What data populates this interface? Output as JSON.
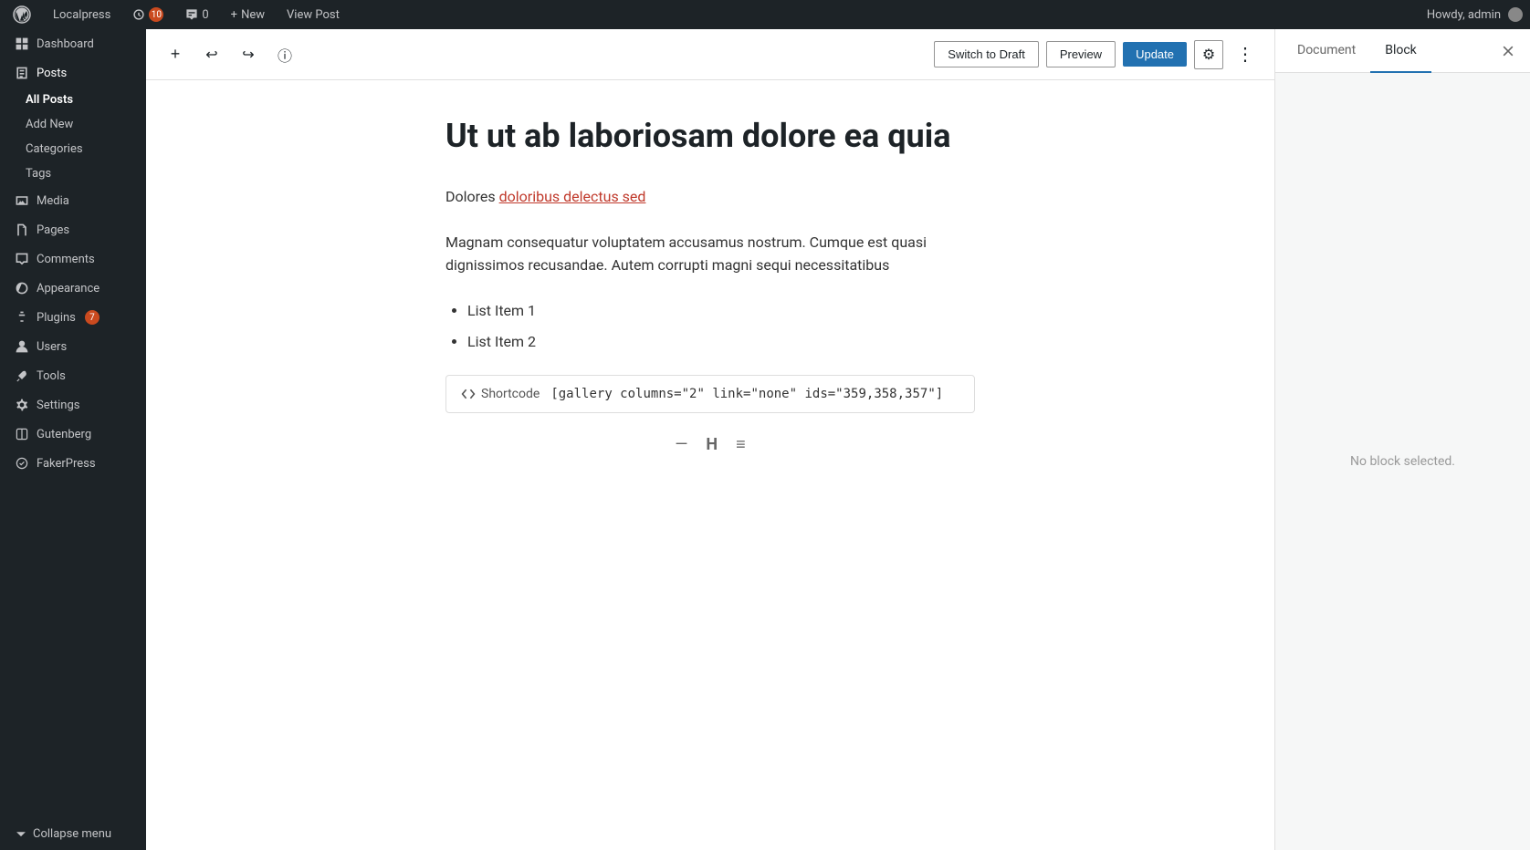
{
  "admin_bar": {
    "site_name": "Localpress",
    "updates_count": "10",
    "comments_count": "0",
    "new_label": "New",
    "view_post_label": "View Post",
    "howdy_label": "Howdy, admin"
  },
  "sidebar": {
    "brand": "Dashboard",
    "items": [
      {
        "id": "dashboard",
        "label": "Dashboard",
        "icon": "dashboard"
      },
      {
        "id": "posts",
        "label": "Posts",
        "icon": "posts",
        "active": true,
        "sub_items": [
          {
            "id": "all-posts",
            "label": "All Posts",
            "active": true
          },
          {
            "id": "add-new",
            "label": "Add New"
          },
          {
            "id": "categories",
            "label": "Categories"
          },
          {
            "id": "tags",
            "label": "Tags"
          }
        ]
      },
      {
        "id": "media",
        "label": "Media",
        "icon": "media"
      },
      {
        "id": "pages",
        "label": "Pages",
        "icon": "pages"
      },
      {
        "id": "comments",
        "label": "Comments",
        "icon": "comments"
      },
      {
        "id": "appearance",
        "label": "Appearance",
        "icon": "appearance"
      },
      {
        "id": "plugins",
        "label": "Plugins",
        "icon": "plugins",
        "badge": "7"
      },
      {
        "id": "users",
        "label": "Users",
        "icon": "users"
      },
      {
        "id": "tools",
        "label": "Tools",
        "icon": "tools"
      },
      {
        "id": "settings",
        "label": "Settings",
        "icon": "settings"
      },
      {
        "id": "gutenberg",
        "label": "Gutenberg",
        "icon": "gutenberg"
      },
      {
        "id": "fakerpress",
        "label": "FakerPress",
        "icon": "fakerpress"
      }
    ],
    "collapse_label": "Collapse menu"
  },
  "toolbar": {
    "switch_to_draft_label": "Switch to Draft",
    "preview_label": "Preview",
    "update_label": "Update"
  },
  "right_panel": {
    "tabs": [
      {
        "id": "document",
        "label": "Document"
      },
      {
        "id": "block",
        "label": "Block",
        "active": true
      }
    ],
    "no_block_selected": "No block selected."
  },
  "editor": {
    "title": "Ut ut ab laboriosam dolore ea quia",
    "paragraph1": "Dolores doloribus delectus sed",
    "paragraph1_link": "doloribus delectus sed",
    "paragraph2": "Magnam consequatur voluptatem accusamus nostrum. Cumque est quasi dignissimos recusandae. Autem corrupti magni sequi necessitatibus",
    "list_items": [
      {
        "text": "List Item 1"
      },
      {
        "text": "List Item 2"
      }
    ],
    "shortcode": {
      "label": "Shortcode",
      "value": "[gallery columns=\"2\" link=\"none\" ids=\"359,358,357\"]"
    }
  }
}
